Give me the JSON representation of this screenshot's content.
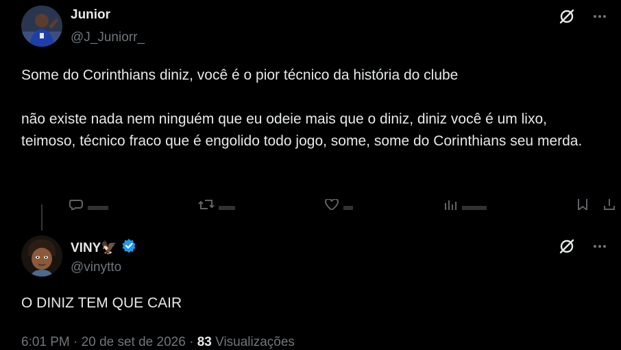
{
  "tweets": [
    {
      "display_name": "Junior",
      "handle": "@J_Juniorr_",
      "text": "Some do Corinthians diniz, você é o pior técnico da história do clube\n\nnão existe nada nem ninguém que eu odeie mais que o diniz, diniz você é um lixo, teimoso, técnico fraco que é engolido todo jogo, some, some do Corinthians seu merda.",
      "icons": [
        "grok-icon",
        "more-icon"
      ],
      "action_icons": [
        "reply-icon",
        "retweet-icon",
        "like-icon",
        "views-icon",
        "bookmark-icon",
        "share-icon"
      ]
    },
    {
      "display_name": "VINY🦅",
      "handle": "@vinytto",
      "verified": true,
      "text": "O DINIZ TEM QUE CAIR",
      "time": "6:01 PM",
      "date": "20 de set de 2026",
      "separator": "·",
      "views_count": "83",
      "views_label": "Visualizações",
      "icons": [
        "grok-icon",
        "more-icon"
      ]
    }
  ],
  "colors": {
    "background": "#000000",
    "text_primary": "#e7e9ea",
    "text_secondary": "#71767b",
    "verified_blue": "#1d9bf0",
    "thread_line": "#333639"
  }
}
